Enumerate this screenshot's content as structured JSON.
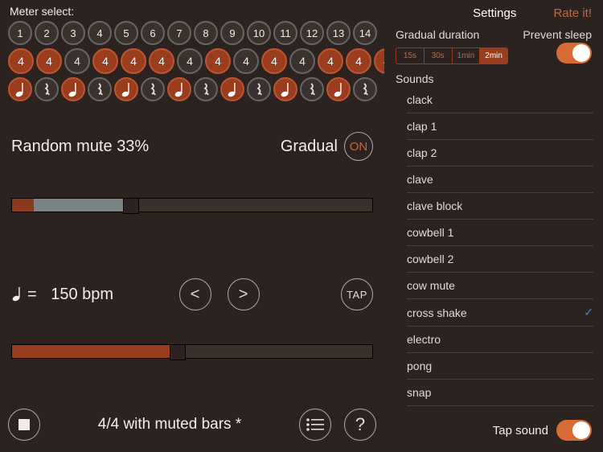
{
  "meter": {
    "label": "Meter select:",
    "row1": [
      "1",
      "2",
      "3",
      "4",
      "5",
      "6",
      "7",
      "8",
      "9",
      "10",
      "11",
      "12",
      "13",
      "14"
    ],
    "row2": {
      "value": "4",
      "count": 14,
      "red_indices": [
        0,
        1,
        3,
        4,
        5,
        7,
        9,
        11,
        12,
        13
      ]
    },
    "row3": {
      "count": 14,
      "red_indices": [
        0,
        2,
        4,
        6,
        8,
        10,
        12
      ],
      "rest_indices": [
        1,
        3,
        5,
        7,
        9,
        11,
        13
      ]
    }
  },
  "random_mute": {
    "label": "Random mute",
    "percent": "33%"
  },
  "gradual": {
    "label": "Gradual",
    "state": "ON"
  },
  "slider1": {
    "red_pct": 6,
    "gray_end_pct": 33
  },
  "tempo": {
    "value": "150 bpm",
    "equals": "="
  },
  "controls": {
    "prev": "<",
    "next": ">",
    "tap": "TAP"
  },
  "slider2": {
    "fill_pct": 46
  },
  "preset": {
    "label": "4/4 with muted bars *"
  },
  "help": {
    "label": "?"
  },
  "sidebar": {
    "settings": "Settings",
    "rate": "Rate it!",
    "gradual_duration_label": "Gradual duration",
    "prevent_sleep_label": "Prevent sleep",
    "segments": [
      "15s",
      "30s",
      "1min",
      "2min"
    ],
    "segment_selected": 3,
    "sounds_label": "Sounds",
    "sounds": [
      "clack",
      "clap 1",
      "clap 2",
      "clave",
      "clave block",
      "cowbell 1",
      "cowbell 2",
      "cow mute",
      "cross shake",
      "electro",
      "pong",
      "snap"
    ],
    "sound_selected": 8,
    "tap_sound_label": "Tap sound"
  }
}
